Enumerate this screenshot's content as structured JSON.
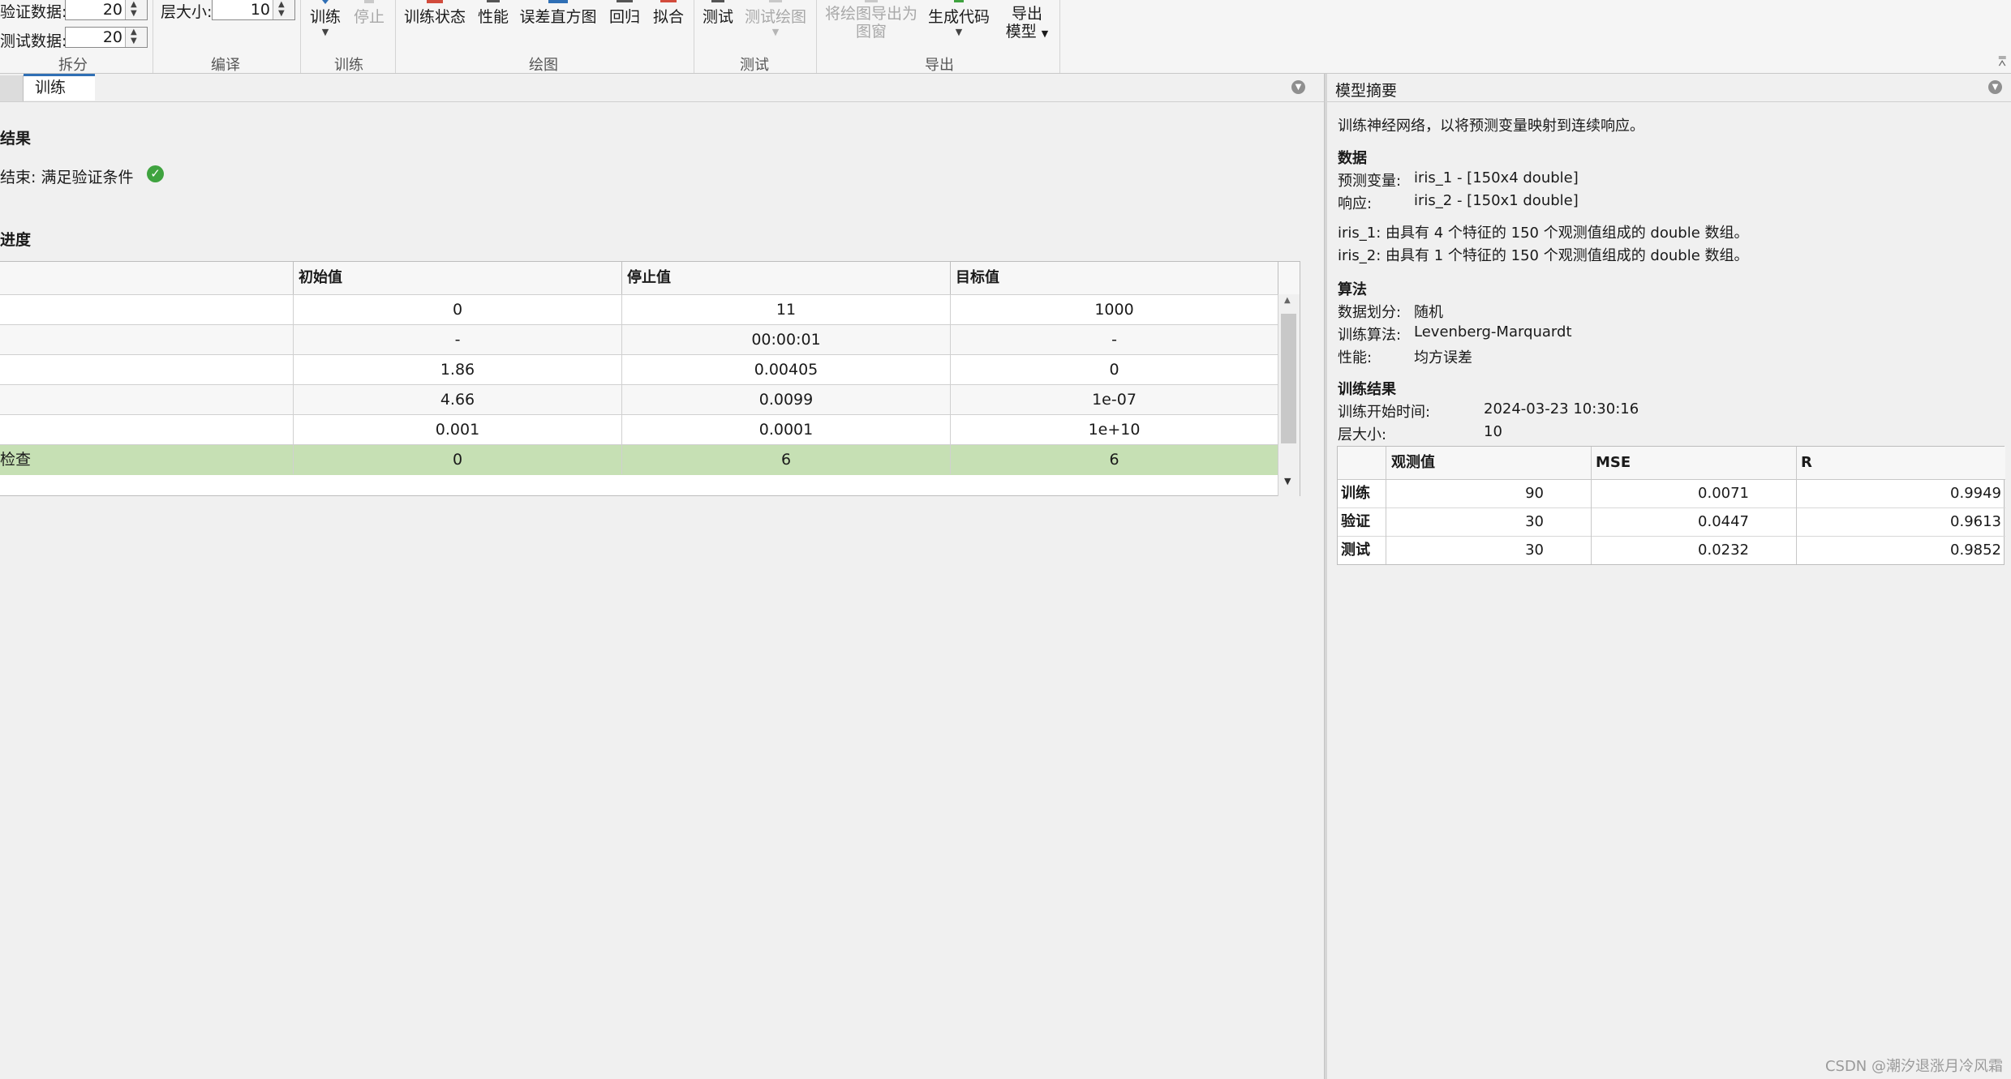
{
  "toolstrip": {
    "split": {
      "section_label": "拆分",
      "validation_label": "验证数据:",
      "validation_value": "20",
      "test_label": "测试数据:",
      "test_value": "20"
    },
    "compile": {
      "section_label": "编译",
      "layer_size_label": "层大小:",
      "layer_size_value": "10"
    },
    "train": {
      "section_label": "训练",
      "train_label": "训练",
      "stop_label": "停止"
    },
    "plots": {
      "section_label": "绘图",
      "buttons": [
        "训练状态",
        "性能",
        "误差直方图",
        "回归",
        "拟合"
      ]
    },
    "test": {
      "section_label": "测试",
      "test_label": "测试",
      "test_plot_label": "测试绘图"
    },
    "export": {
      "section_label": "导出",
      "export_plot_line1": "将绘图导出为",
      "export_plot_line2": "图窗",
      "gen_code_label": "生成代码",
      "export_model_line1": "导出",
      "export_model_line2": "模型"
    }
  },
  "left": {
    "tab_label": "训练",
    "results_heading": "结果",
    "results_status": "结束: 满足验证条件",
    "progress_heading": "进度",
    "table": {
      "headers": [
        "初始值",
        "停止值",
        "目标值"
      ],
      "rows": [
        {
          "label": "",
          "initial": "0",
          "stop": "11",
          "target": "1000"
        },
        {
          "label": "",
          "initial": "-",
          "stop": "00:00:01",
          "target": "-"
        },
        {
          "label": "",
          "initial": "1.86",
          "stop": "0.00405",
          "target": "0"
        },
        {
          "label": "",
          "initial": "4.66",
          "stop": "0.0099",
          "target": "1e-07"
        },
        {
          "label": "",
          "initial": "0.001",
          "stop": "0.0001",
          "target": "1e+10"
        },
        {
          "label": "检查",
          "initial": "0",
          "stop": "6",
          "target": "6"
        }
      ]
    }
  },
  "right": {
    "title": "模型摘要",
    "intro": "训练神经网络，以将预测变量映射到连续响应。",
    "data_heading": "数据",
    "predictors_label": "预测变量:",
    "predictors_value": "iris_1 - [150x4 double]",
    "response_label": "响应:",
    "response_value": "iris_2 - [150x1 double]",
    "desc1": "iris_1: 由具有 4 个特征的 150 个观测值组成的 double 数组。",
    "desc2": "iris_2: 由具有 1 个特征的 150 个观测值组成的 double 数组。",
    "algo_heading": "算法",
    "split_label": "数据划分:",
    "split_value": "随机",
    "train_algo_label": "训练算法:",
    "train_algo_value": "Levenberg-Marquardt",
    "perf_label": "性能:",
    "perf_value": "均方误差",
    "results_heading": "训练结果",
    "start_time_label": "训练开始时间:",
    "start_time_value": "2024-03-23 10:30:16",
    "layer_size_label": "层大小:",
    "layer_size_value": "10",
    "results_table": {
      "headers": [
        "观测值",
        "MSE",
        "R"
      ],
      "rows": [
        {
          "name": "训练",
          "obs": "90",
          "mse": "0.0071",
          "r": "0.9949"
        },
        {
          "name": "验证",
          "obs": "30",
          "mse": "0.0447",
          "r": "0.9613"
        },
        {
          "name": "测试",
          "obs": "30",
          "mse": "0.0232",
          "r": "0.9852"
        }
      ]
    }
  },
  "watermark": "CSDN @潮汐退涨月冷风霜",
  "colors": {
    "accent": "#2f6fb5",
    "success": "#3fa33f",
    "highlight_row": "#c6e0b4"
  }
}
